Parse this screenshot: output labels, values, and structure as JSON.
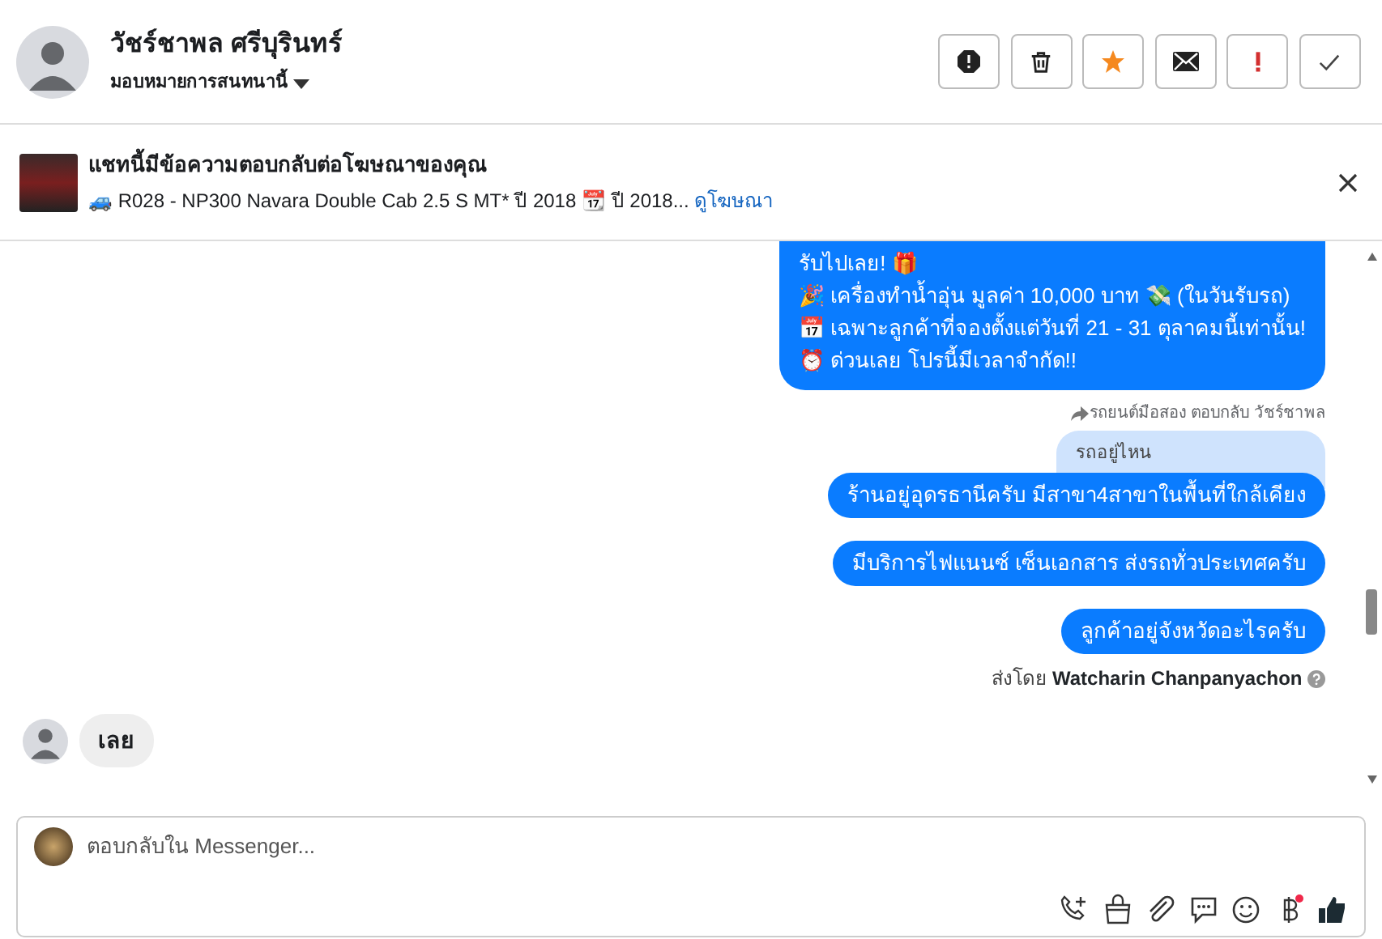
{
  "contact": {
    "name": "วัชร์ชาพล ศรีบุรินทร์",
    "assign_label": "มอบหมายการสนทนานี้"
  },
  "ad_banner": {
    "title": "แชทนี้มีข้อความตอบกลับต่อโฆษณาของคุณ",
    "details": "🚙 R028 - NP300 Navara Double Cab 2.5 S MT* ปี 2018 📆 ปี 2018...",
    "link": "ดูโฆษณา"
  },
  "messages": [
    {
      "kind": "outgoing_multi",
      "lines": [
        "รับไปเลย! 🎁",
        "🎉 เครื่องทำน้ำอุ่น มูลค่า 10,000 บาท 💸 (ในวันรับรถ)",
        "📅 เฉพาะลูกค้าที่จองตั้งแต่วันที่ 21 - 31 ตุลาคมนี้เท่านั้น!",
        "⏰ ด่วนเลย โปรนี้มีเวลาจำกัด!!"
      ]
    },
    {
      "kind": "reply_context",
      "text": "รถยนต์มือสอง ตอบกลับ วัชร์ชาพล"
    },
    {
      "kind": "quoted",
      "text": "รถอยู่ไหน"
    },
    {
      "kind": "outgoing",
      "text": "ร้านอยู่อุดรธานีครับ มีสาขา4สาขาในพื้นที่ใกล้เคียง"
    },
    {
      "kind": "outgoing",
      "text": "มีบริการไฟแนนซ์ เซ็นเอกสาร ส่งรถทั่วประเทศครับ"
    },
    {
      "kind": "outgoing",
      "text": "ลูกค้าอยู่จังหวัดอะไรครับ"
    },
    {
      "kind": "sent_by",
      "prefix": "ส่งโดย",
      "name": "Watcharin Chanpanyachon"
    },
    {
      "kind": "incoming",
      "text": "เลย"
    }
  ],
  "composer": {
    "placeholder": "ตอบกลับใน Messenger..."
  }
}
